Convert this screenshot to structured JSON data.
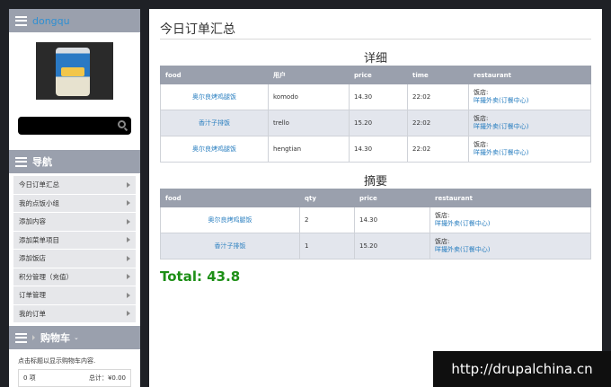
{
  "sidebar": {
    "user_name": "dongqu",
    "search": {
      "value": "",
      "placeholder": ""
    },
    "nav_title": "导航",
    "nav_items": [
      "今日订单汇总",
      "我的点饭小组",
      "添加内容",
      "添加菜单项目",
      "添加饭店",
      "积分管理（充值）",
      "订单管理",
      "我的订单"
    ],
    "cart": {
      "title": "购物车",
      "hint": "点击标题以显示购物车内容.",
      "count": "0 项",
      "total_label": "总计：",
      "total_value": "¥0.00"
    }
  },
  "main": {
    "page_title": "今日订单汇总",
    "detail": {
      "title": "详细",
      "headers": [
        "food",
        "用户",
        "price",
        "time",
        "restaurant"
      ],
      "rows": [
        {
          "food": "奥尔良烤鸡腿饭",
          "user": "komodo",
          "price": "14.30",
          "time": "22:02",
          "rest_label": "饭店:",
          "rest_link": "咩撮外卖(订餐中心)"
        },
        {
          "food": "香汁子排饭",
          "user": "trello",
          "price": "15.20",
          "time": "22:02",
          "rest_label": "饭店:",
          "rest_link": "咩撮外卖(订餐中心)"
        },
        {
          "food": "奥尔良烤鸡腿饭",
          "user": "hengtian",
          "price": "14.30",
          "time": "22:02",
          "rest_label": "饭店:",
          "rest_link": "咩撮外卖(订餐中心)"
        }
      ]
    },
    "summary": {
      "title": "摘要",
      "headers": [
        "food",
        "qty",
        "price",
        "restaurant"
      ],
      "rows": [
        {
          "food": "奥尔良烤鸡腿饭",
          "qty": "2",
          "price": "14.30",
          "rest_label": "饭店:",
          "rest_link": "咩撮外卖(订餐中心)"
        },
        {
          "food": "香汁子排饭",
          "qty": "1",
          "price": "15.20",
          "rest_label": "饭店:",
          "rest_link": "咩撮外卖(订餐中心)"
        }
      ]
    },
    "total": "Total: 43.8"
  },
  "watermark": "http://drupalchina.cn",
  "colors": {
    "header_bg": "#9aa0ad",
    "link": "#2a7fc0",
    "total": "#1d8f16",
    "alt_row": "#e3e6ed"
  },
  "icons": [
    "menu-icon",
    "search-icon",
    "chevron-right-icon"
  ]
}
